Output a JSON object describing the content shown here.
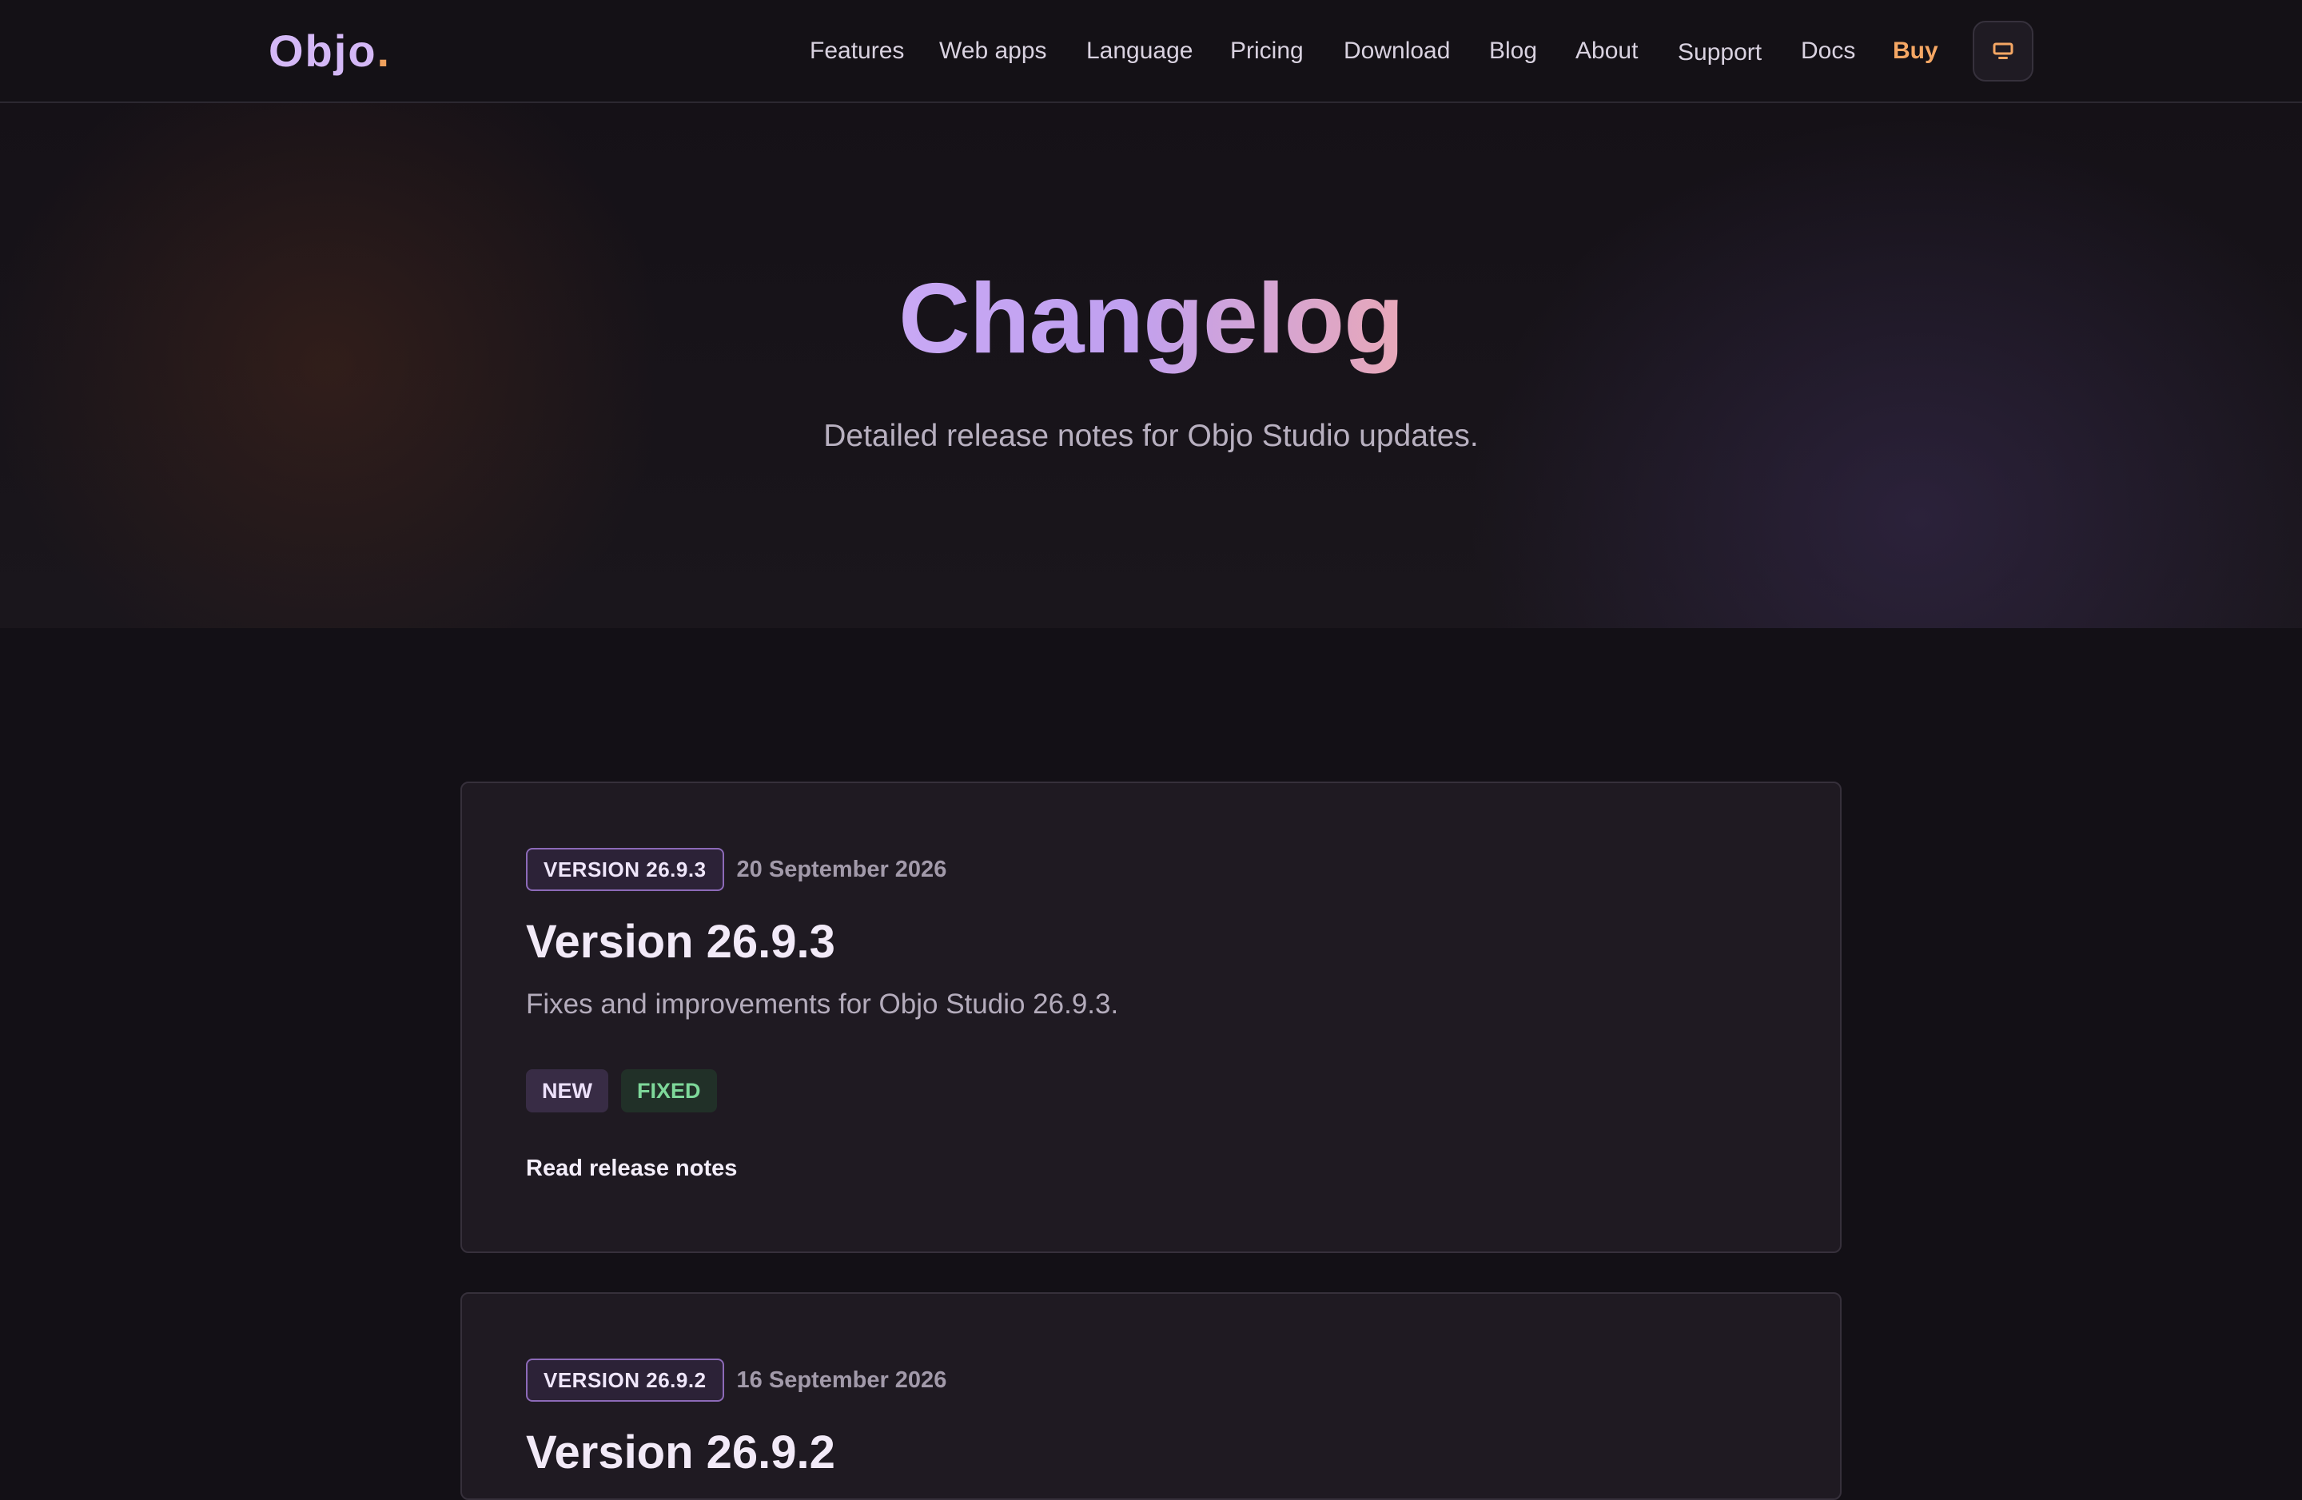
{
  "header": {
    "logo_text": "Objo",
    "logo_dot": ".",
    "nav": [
      {
        "label": "Features"
      },
      {
        "label": "Web apps"
      },
      {
        "label": "Language"
      },
      {
        "label": "Pricing"
      },
      {
        "label": "Download"
      },
      {
        "label": "Blog"
      },
      {
        "label": "About"
      },
      {
        "label": "Support"
      },
      {
        "label": "Docs"
      },
      {
        "label": "Buy"
      }
    ],
    "theme_toggle_icon": "monitor-icon"
  },
  "hero": {
    "title": "Changelog",
    "subtitle": "Detailed release notes for Objo Studio updates."
  },
  "releases": [
    {
      "badge": "VERSION 26.9.3",
      "date": "20 September 2026",
      "title": "Version 26.9.3",
      "description": "Fixes and improvements for Objo Studio 26.9.3.",
      "tags": [
        "NEW",
        "FIXED"
      ],
      "link_label": "Read release notes"
    },
    {
      "badge": "VERSION 26.9.2",
      "date": "16 September 2026",
      "title": "Version 26.9.2"
    }
  ],
  "colors": {
    "background": "#131016",
    "accent_purple": "#c8a8f4",
    "accent_orange": "#f5a764",
    "tag_fixed_green": "#7ed89a"
  }
}
